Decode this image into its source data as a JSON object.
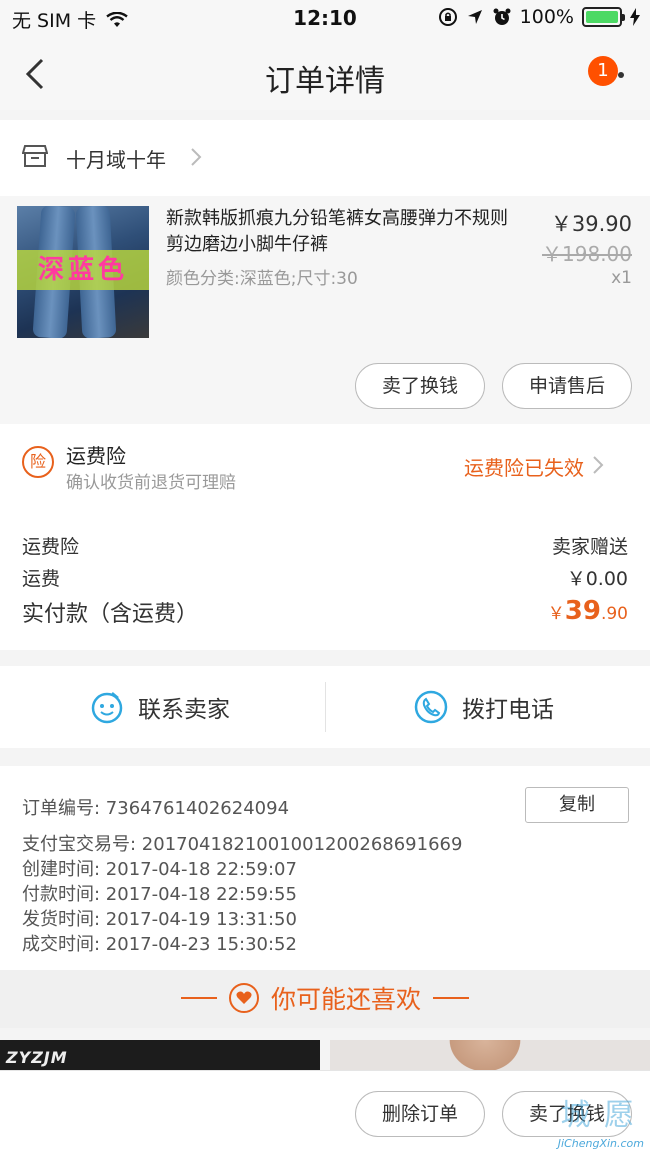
{
  "status_bar": {
    "carrier": "无 SIM 卡",
    "time": "12:10",
    "battery": "100%"
  },
  "nav": {
    "title": "订单详情",
    "badge": "1"
  },
  "shop": {
    "name": "十月域十年"
  },
  "product": {
    "title": "新款韩版抓痕九分铅笔裤女高腰弹力不规则剪边磨边小脚牛仔裤",
    "spec": "颜色分类:深蓝色;尺寸:30",
    "image_tag": "深蓝色",
    "price": "￥39.90",
    "original_price": "￥198.00",
    "quantity": "x1",
    "btn_sell": "卖了换钱",
    "btn_after_sale": "申请售后"
  },
  "insurance": {
    "icon_char": "险",
    "title": "运费险",
    "subtitle": "确认收货前退货可理赔",
    "status": "运费险已失效"
  },
  "fees": {
    "ins_label": "运费险",
    "ins_value": "卖家赠送",
    "ship_label": "运费",
    "ship_value": "￥0.00",
    "total_label": "实付款（含运费）",
    "total_currency": "￥",
    "total_int": "39",
    "total_dec": ".90"
  },
  "contact": {
    "seller": "联系卖家",
    "phone": "拨打电话"
  },
  "order_info": {
    "order_no": "订单编号:   7364761402624094",
    "copy": "复制",
    "alipay_no": "支付宝交易号:   2017041821001001200268691669",
    "created": "创建时间:   2017-04-18 22:59:07",
    "paid": "付款时间:   2017-04-18 22:59:55",
    "shipped": "发货时间:   2017-04-19 13:31:50",
    "closed": "成交时间:   2017-04-23 15:30:52"
  },
  "recommend": {
    "title": "你可能还喜欢",
    "tile_brand": "ZYZJM"
  },
  "bottom": {
    "delete": "删除订单",
    "sell": "卖了换钱"
  },
  "watermark": {
    "logo": "城 愿",
    "site": "JiChengXin.com"
  },
  "colors": {
    "accent": "#e8611c",
    "badge": "#ff5000",
    "contact_icon": "#2fa8e0"
  }
}
